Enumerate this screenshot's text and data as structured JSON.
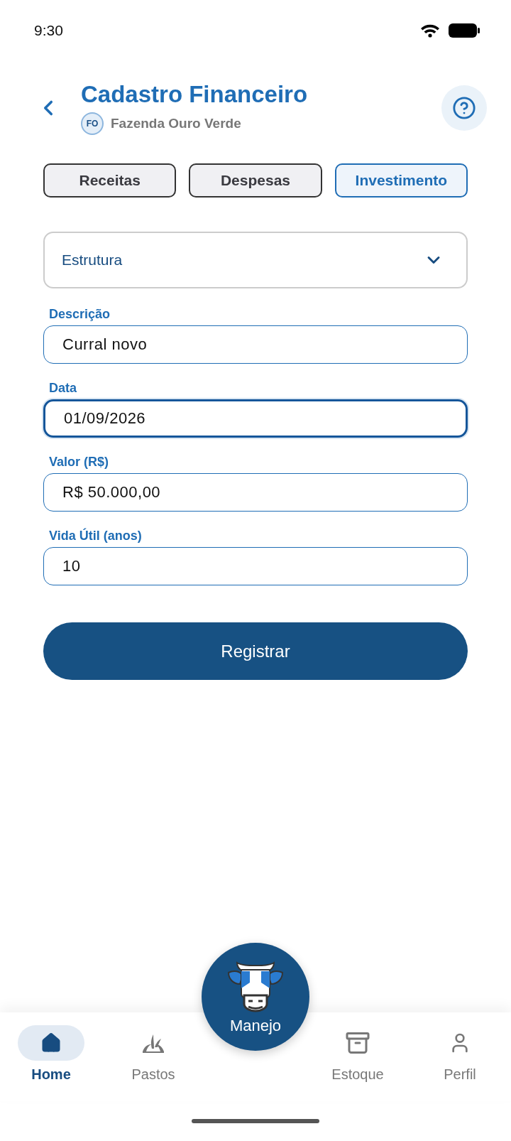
{
  "status_bar": {
    "time": "9:30"
  },
  "header": {
    "title": "Cadastro Financeiro",
    "farm_badge": "FO",
    "farm_name": "Fazenda Ouro Verde"
  },
  "tabs": [
    {
      "label": "Receitas",
      "selected": false
    },
    {
      "label": "Despesas",
      "selected": false
    },
    {
      "label": "Investimento",
      "selected": true
    }
  ],
  "category_select": {
    "value": "Estrutura"
  },
  "fields": [
    {
      "label": "Descrição",
      "value": "Curral novo",
      "focused": false
    },
    {
      "label": "Data",
      "value": "01/09/2026",
      "focused": true
    },
    {
      "label": "Valor (R$)",
      "value": "R$ 50.000,00",
      "focused": false
    },
    {
      "label": "Vida Útil (anos)",
      "value": "10",
      "focused": false
    }
  ],
  "submit_button": "Registrar",
  "bottom_nav": {
    "center": {
      "label": "Manejo"
    },
    "items": [
      {
        "kind": "home",
        "label": "Home",
        "selected": true
      },
      {
        "kind": "pastos",
        "label": "Pastos",
        "selected": false
      },
      {
        "kind": "estoque",
        "label": "Estoque",
        "selected": false
      },
      {
        "kind": "perfil",
        "label": "Perfil",
        "selected": false
      }
    ]
  }
}
